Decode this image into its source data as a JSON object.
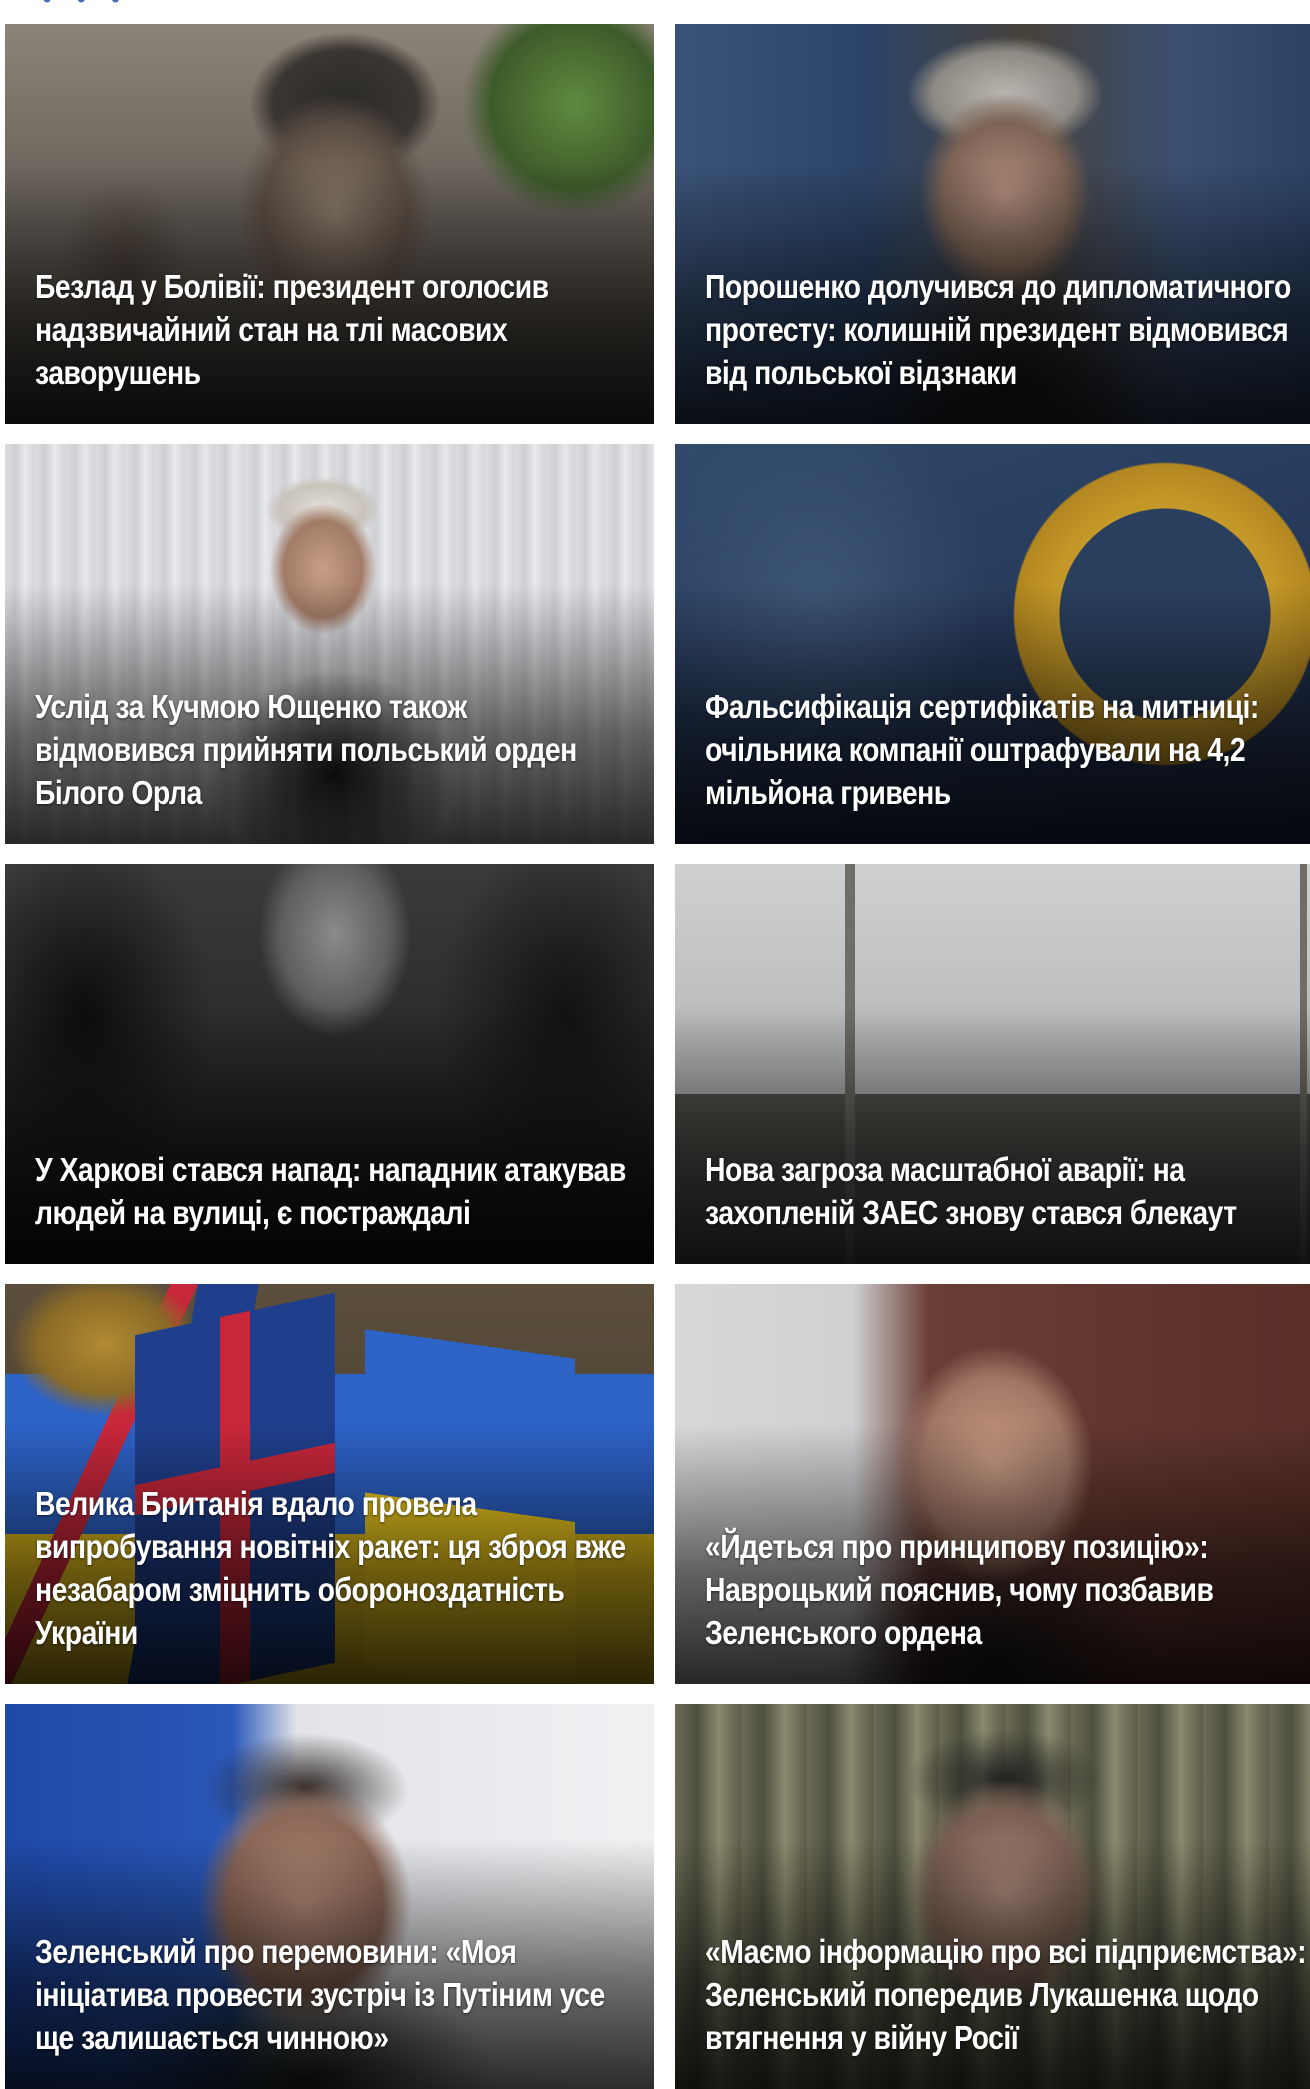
{
  "news_grid": {
    "items": [
      {
        "headline": "Безлад у Болівії: президент оголосив надзвичайний стан на тлі масових заворушень"
      },
      {
        "headline": "Порошенко долучився до дипломатичного протесту: колишній президент відмовився від польської відзнаки"
      },
      {
        "headline": "Услід за Кучмою Ющенко також відмовився прийняти польський орден Білого Орла"
      },
      {
        "headline": "Фальсифікація сертифікатів на митниці: очільника компанії оштрафували на 4,2 мільйона гривень"
      },
      {
        "headline": "У Харкові стався напад: нападник атакував людей на вулиці, є постраждалі"
      },
      {
        "headline": "Нова загроза масштабної аварії: на захопленій ЗАЕС знову стався блекаут"
      },
      {
        "headline": "Велика Британія вдало провела випробування новітніх ракет: ця зброя вже незабаром зміцнить обороноздатність України"
      },
      {
        "headline": "«Йдеться про принципову позицію»: Навроцький пояснив, чому позбавив Зеленського ордена"
      },
      {
        "headline": "Зеленський про перемовини: «Моя ініціатива провести зустріч із Путіним усе ще залишається чинною»"
      },
      {
        "headline": "«Маємо інформацію про всі підприємства»: Зеленський попередив Лукашенка щодо втягнення у війну Росії"
      }
    ]
  }
}
